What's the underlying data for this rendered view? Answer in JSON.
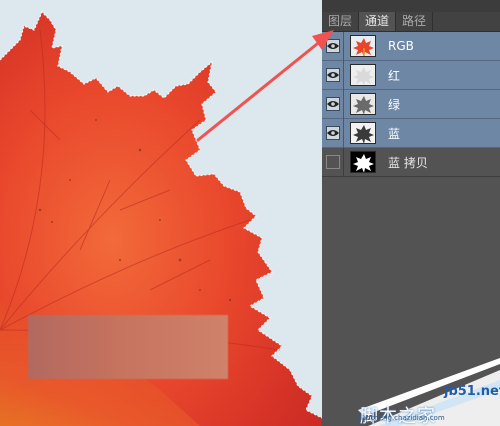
{
  "panel": {
    "tabs": [
      {
        "label": "图层",
        "active": false
      },
      {
        "label": "通道",
        "active": true
      },
      {
        "label": "路径",
        "active": false
      }
    ],
    "channels": [
      {
        "name": "RGB",
        "visible": true,
        "selected": true,
        "thumbnail": "color-leaf"
      },
      {
        "name": "红",
        "visible": true,
        "selected": true,
        "thumbnail": "light-gray-leaf"
      },
      {
        "name": "绿",
        "visible": true,
        "selected": true,
        "thumbnail": "gray-leaf"
      },
      {
        "name": "蓝",
        "visible": true,
        "selected": true,
        "thumbnail": "dark-gray-leaf"
      },
      {
        "name": "蓝 拷贝",
        "visible": false,
        "selected": false,
        "thumbnail": "black-white-mask"
      }
    ]
  },
  "watermark": {
    "url": "jb51.net",
    "site_name": "脚本之家",
    "small_text": "jiaocheng.chazidian.com"
  },
  "colors": {
    "selected_row": "#6d87a5",
    "panel_bg": "#535353",
    "arrow": "#f0524f",
    "leaf": "#e8452c"
  }
}
